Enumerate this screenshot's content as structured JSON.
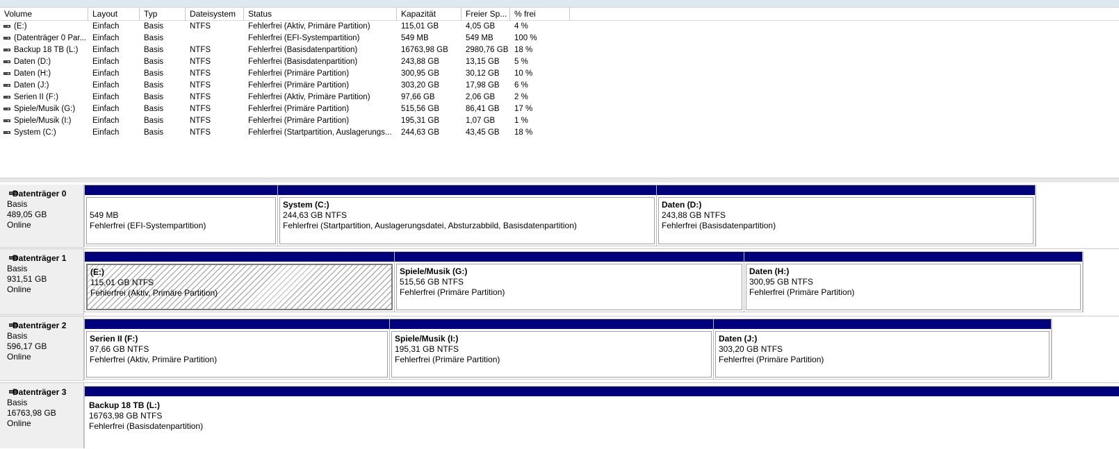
{
  "columns": [
    "Volume",
    "Layout",
    "Typ",
    "Dateisystem",
    "Status",
    "Kapazität",
    "Freier Sp...",
    "% frei"
  ],
  "volumes": [
    {
      "volume": "(E:)",
      "layout": "Einfach",
      "typ": "Basis",
      "fs": "NTFS",
      "status": "Fehlerfrei (Aktiv, Primäre Partition)",
      "kap": "115,01 GB",
      "frei": "4,05 GB",
      "pct": "4 %"
    },
    {
      "volume": "(Datenträger 0 Par...",
      "layout": "Einfach",
      "typ": "Basis",
      "fs": "",
      "status": "Fehlerfrei (EFI-Systempartition)",
      "kap": "549 MB",
      "frei": "549 MB",
      "pct": "100 %"
    },
    {
      "volume": "Backup 18 TB (L:)",
      "layout": "Einfach",
      "typ": "Basis",
      "fs": "NTFS",
      "status": "Fehlerfrei (Basisdatenpartition)",
      "kap": "16763,98 GB",
      "frei": "2980,76 GB",
      "pct": "18 %"
    },
    {
      "volume": "Daten (D:)",
      "layout": "Einfach",
      "typ": "Basis",
      "fs": "NTFS",
      "status": "Fehlerfrei (Basisdatenpartition)",
      "kap": "243,88 GB",
      "frei": "13,15 GB",
      "pct": "5 %"
    },
    {
      "volume": "Daten (H:)",
      "layout": "Einfach",
      "typ": "Basis",
      "fs": "NTFS",
      "status": "Fehlerfrei (Primäre Partition)",
      "kap": "300,95 GB",
      "frei": "30,12 GB",
      "pct": "10 %"
    },
    {
      "volume": "Daten (J:)",
      "layout": "Einfach",
      "typ": "Basis",
      "fs": "NTFS",
      "status": "Fehlerfrei (Primäre Partition)",
      "kap": "303,20 GB",
      "frei": "17,98 GB",
      "pct": "6 %"
    },
    {
      "volume": "Serien II (F:)",
      "layout": "Einfach",
      "typ": "Basis",
      "fs": "NTFS",
      "status": "Fehlerfrei (Aktiv, Primäre Partition)",
      "kap": "97,66 GB",
      "frei": "2,06 GB",
      "pct": "2 %"
    },
    {
      "volume": "Spiele/Musik (G:)",
      "layout": "Einfach",
      "typ": "Basis",
      "fs": "NTFS",
      "status": "Fehlerfrei (Primäre Partition)",
      "kap": "515,56 GB",
      "frei": "86,41 GB",
      "pct": "17 %"
    },
    {
      "volume": "Spiele/Musik (I:)",
      "layout": "Einfach",
      "typ": "Basis",
      "fs": "NTFS",
      "status": "Fehlerfrei (Primäre Partition)",
      "kap": "195,31 GB",
      "frei": "1,07 GB",
      "pct": "1 %"
    },
    {
      "volume": "System (C:)",
      "layout": "Einfach",
      "typ": "Basis",
      "fs": "NTFS",
      "status": "Fehlerfrei (Startpartition, Auslagerungs...",
      "kap": "244,63 GB",
      "frei": "43,45 GB",
      "pct": "18 %"
    }
  ],
  "disks": [
    {
      "name": "Datenträger 0",
      "type": "Basis",
      "size": "489,05 GB",
      "state": "Online",
      "partitions": [
        {
          "name": "",
          "size": "549 MB",
          "status": "Fehlerfrei (EFI-Systempartition)"
        },
        {
          "name": "System  (C:)",
          "size": "244,63 GB NTFS",
          "status": "Fehlerfrei (Startpartition, Auslagerungsdatei, Absturzabbild, Basisdatenpartition)"
        },
        {
          "name": "Daten  (D:)",
          "size": "243,88 GB NTFS",
          "status": "Fehlerfrei (Basisdatenpartition)"
        }
      ]
    },
    {
      "name": "Datenträger 1",
      "type": "Basis",
      "size": "931,51 GB",
      "state": "Online",
      "partitions": [
        {
          "name": "(E:)",
          "size": "115,01 GB NTFS",
          "status": "Fehlerfrei (Aktiv, Primäre Partition)"
        },
        {
          "name": "Spiele/Musik  (G:)",
          "size": "515,56 GB NTFS",
          "status": "Fehlerfrei (Primäre Partition)"
        },
        {
          "name": "Daten  (H:)",
          "size": "300,95 GB NTFS",
          "status": "Fehlerfrei (Primäre Partition)"
        }
      ]
    },
    {
      "name": "Datenträger 2",
      "type": "Basis",
      "size": "596,17 GB",
      "state": "Online",
      "partitions": [
        {
          "name": "Serien II  (F:)",
          "size": "97,66 GB NTFS",
          "status": "Fehlerfrei (Aktiv, Primäre Partition)"
        },
        {
          "name": "Spiele/Musik  (I:)",
          "size": "195,31 GB NTFS",
          "status": "Fehlerfrei (Primäre Partition)"
        },
        {
          "name": "Daten  (J:)",
          "size": "303,20 GB NTFS",
          "status": "Fehlerfrei (Primäre Partition)"
        }
      ]
    },
    {
      "name": "Datenträger 3",
      "type": "Basis",
      "size": "16763,98 GB",
      "state": "Online",
      "partitions": [
        {
          "name": "Backup 18 TB  (L:)",
          "size": "16763,98 GB NTFS",
          "status": "Fehlerfrei (Basisdatenpartition)"
        }
      ]
    }
  ],
  "colors": {
    "partition_header": "#00007f",
    "disk_label_bg": "#efefef",
    "hatch": "#9a9a9a"
  },
  "icons": {
    "volume": "drive-icon",
    "disk": "disk-icon"
  }
}
